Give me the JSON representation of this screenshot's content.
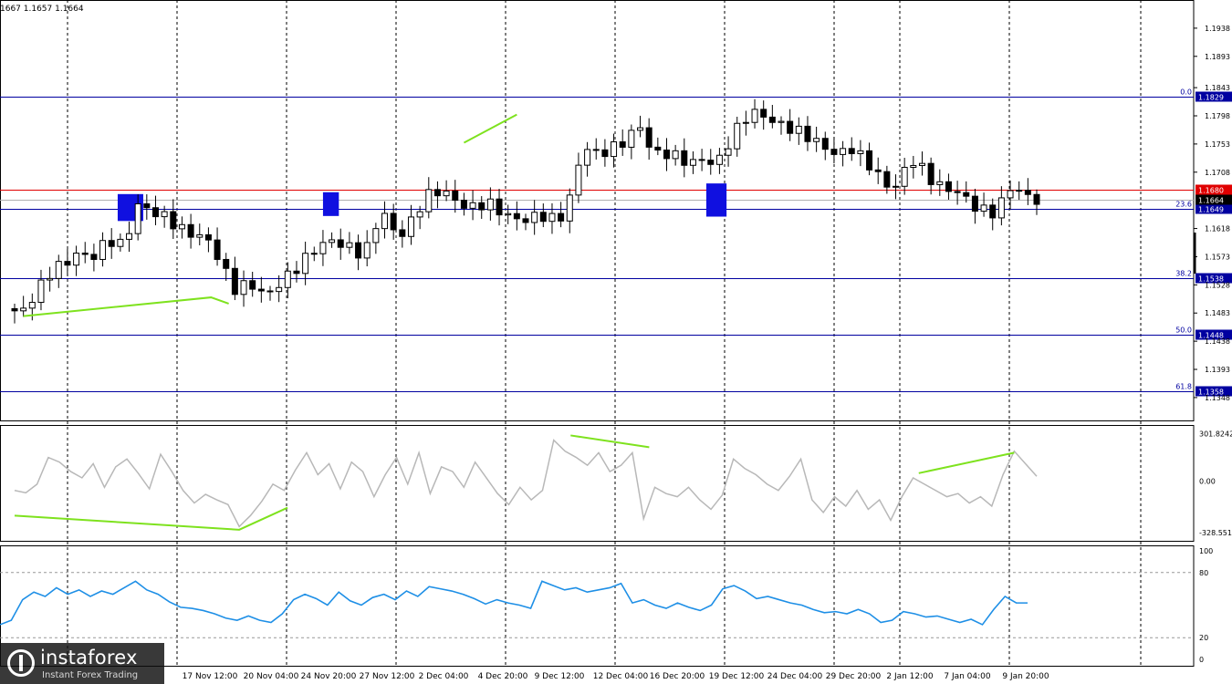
{
  "header": {
    "ohlc": "1667 1.1657 1.1664"
  },
  "logo": {
    "name": "instaforex",
    "tagline": "Instant Forex Trading"
  },
  "colors": {
    "background": "#ffffff",
    "grid": "#000000",
    "candle": "#000000",
    "level": "#0000a0",
    "resistance": "#e00000",
    "current": "#b0b0b0",
    "divergence": "#7ee21e",
    "zone": "#1010e0",
    "cci": "#b8b8b8",
    "rsi": "#1e8fe6"
  },
  "chart_data": [
    {
      "type": "candlestick",
      "name": "price",
      "ylim": [
        1.131,
        1.1983
      ],
      "y_ticks": [
        "1.1938",
        "1.1893",
        "1.1843",
        "1.1798",
        "1.1753",
        "1.1708",
        "1.1618",
        "1.1573",
        "1.1528",
        "1.1483",
        "1.1438",
        "1.1393",
        "1.1348"
      ],
      "x_ticks": [
        "17 Nov 12:00",
        "20 Nov 04:00",
        "24 Nov 20:00",
        "27 Nov 12:00",
        "2 Dec 04:00",
        "4 Dec 20:00",
        "9 Dec 12:00",
        "12 Dec 04:00",
        "16 Dec 20:00",
        "19 Dec 12:00",
        "24 Dec 04:00",
        "29 Dec 20:00",
        "2 Jan 12:00",
        "7 Jan 04:00",
        "9 Jan 20:00"
      ],
      "close_path": [
        [
          0,
          1.149
        ],
        [
          1,
          1.148
        ],
        [
          2,
          1.15
        ],
        [
          4,
          1.154
        ],
        [
          5,
          1.156
        ],
        [
          6,
          1.1555
        ],
        [
          7,
          1.158
        ],
        [
          9,
          1.157
        ],
        [
          11,
          1.16
        ],
        [
          13,
          1.159
        ],
        [
          14,
          1.166
        ],
        [
          15,
          1.165
        ],
        [
          17,
          1.164
        ],
        [
          18,
          1.163
        ],
        [
          20,
          1.161
        ],
        [
          22,
          1.1605
        ],
        [
          24,
          1.156
        ],
        [
          25,
          1.152
        ],
        [
          27,
          1.153
        ],
        [
          29,
          1.151
        ],
        [
          30,
          1.1525
        ],
        [
          32,
          1.155
        ],
        [
          34,
          1.158
        ],
        [
          36,
          1.16
        ],
        [
          38,
          1.159
        ],
        [
          40,
          1.1575
        ],
        [
          41,
          1.161
        ],
        [
          42,
          1.165
        ],
        [
          43,
          1.162
        ],
        [
          44,
          1.1605
        ],
        [
          45,
          1.162
        ],
        [
          47,
          1.167
        ],
        [
          49,
          1.168
        ],
        [
          50,
          1.1665
        ],
        [
          52,
          1.165
        ],
        [
          54,
          1.166
        ],
        [
          56,
          1.164
        ],
        [
          58,
          1.163
        ],
        [
          60,
          1.164
        ],
        [
          62,
          1.163
        ],
        [
          63,
          1.165
        ],
        [
          64,
          1.17
        ],
        [
          65,
          1.1755
        ],
        [
          66,
          1.1735
        ],
        [
          68,
          1.1745
        ],
        [
          70,
          1.176
        ],
        [
          71,
          1.179
        ],
        [
          72,
          1.176
        ],
        [
          73,
          1.1735
        ],
        [
          74,
          1.174
        ],
        [
          76,
          1.173
        ],
        [
          77,
          1.172
        ],
        [
          78,
          1.173
        ],
        [
          80,
          1.172
        ],
        [
          81,
          1.1745
        ],
        [
          82,
          1.177
        ],
        [
          83,
          1.179
        ],
        [
          84,
          1.1805
        ],
        [
          85,
          1.18
        ],
        [
          87,
          1.1785
        ],
        [
          89,
          1.1775
        ],
        [
          91,
          1.176
        ],
        [
          93,
          1.174
        ],
        [
          94,
          1.1735
        ],
        [
          95,
          1.175
        ],
        [
          97,
          1.1725
        ],
        [
          98,
          1.171
        ],
        [
          99,
          1.169
        ],
        [
          100,
          1.168
        ],
        [
          101,
          1.17
        ],
        [
          102,
          1.173
        ],
        [
          103,
          1.172
        ],
        [
          104,
          1.17
        ],
        [
          105,
          1.169
        ],
        [
          106,
          1.168
        ],
        [
          107,
          1.168
        ],
        [
          108,
          1.167
        ],
        [
          109,
          1.1655
        ],
        [
          110,
          1.165
        ],
        [
          111,
          1.164
        ],
        [
          112,
          1.165
        ],
        [
          113,
          1.168
        ],
        [
          114,
          1.1685
        ],
        [
          115,
          1.167
        ],
        [
          116,
          1.1664
        ]
      ],
      "horizontal_levels": [
        {
          "kind": "fibo",
          "label": "0.0",
          "value": 1.1829,
          "tag": "1.1829"
        },
        {
          "kind": "fibo",
          "label": "23.6",
          "value": 1.1649,
          "tag": "1.1649"
        },
        {
          "kind": "fibo",
          "label": "38.2",
          "value": 1.1538,
          "tag": "1.1538"
        },
        {
          "kind": "fibo",
          "label": "50.0",
          "value": 1.1448,
          "tag": "1.1448"
        },
        {
          "kind": "fibo",
          "label": "61.8",
          "value": 1.1358,
          "tag": "1.1358"
        },
        {
          "kind": "resistance",
          "label": "",
          "value": 1.168,
          "tag": "1.1680"
        },
        {
          "kind": "current",
          "label": "",
          "value": 1.1664,
          "tag": "1.1664"
        }
      ],
      "zones": [
        {
          "from": 11.7,
          "to": 14.6,
          "low": 1.163,
          "high": 1.1673
        },
        {
          "from": 35.0,
          "to": 36.8,
          "low": 1.1638,
          "high": 1.1676
        },
        {
          "from": 78.5,
          "to": 80.8,
          "low": 1.1637,
          "high": 1.169
        }
      ],
      "divergence_lines": [
        [
          [
            1,
            1.1478
          ],
          [
            22.3,
            1.1508
          ],
          [
            24.3,
            1.1498
          ]
        ],
        [
          [
            51.0,
            1.1755
          ],
          [
            57.0,
            1.18
          ]
        ]
      ]
    },
    {
      "type": "line",
      "name": "CCI",
      "ylim": [
        -340,
        310
      ],
      "y_ticks": [
        "301.8242",
        "0.00",
        "-328.5518"
      ],
      "series_path": [
        [
          0,
          -60
        ],
        [
          1,
          -75
        ],
        [
          2,
          -20
        ],
        [
          3,
          150
        ],
        [
          4,
          120
        ],
        [
          5,
          60
        ],
        [
          6,
          20
        ],
        [
          7,
          110
        ],
        [
          8,
          -40
        ],
        [
          9,
          90
        ],
        [
          10,
          140
        ],
        [
          11,
          50
        ],
        [
          12,
          -50
        ],
        [
          13,
          170
        ],
        [
          14,
          60
        ],
        [
          15,
          -60
        ],
        [
          16,
          -140
        ],
        [
          17,
          -85
        ],
        [
          18,
          -120
        ],
        [
          19,
          -150
        ],
        [
          20,
          -290
        ],
        [
          21,
          -220
        ],
        [
          22,
          -130
        ],
        [
          23,
          -20
        ],
        [
          24,
          -60
        ],
        [
          25,
          70
        ],
        [
          26,
          180
        ],
        [
          27,
          40
        ],
        [
          28,
          110
        ],
        [
          29,
          -50
        ],
        [
          30,
          120
        ],
        [
          31,
          60
        ],
        [
          32,
          -100
        ],
        [
          33,
          40
        ],
        [
          34,
          150
        ],
        [
          35,
          -20
        ],
        [
          36,
          180
        ],
        [
          37,
          -80
        ],
        [
          38,
          90
        ],
        [
          39,
          60
        ],
        [
          40,
          -40
        ],
        [
          41,
          120
        ],
        [
          42,
          20
        ],
        [
          43,
          -80
        ],
        [
          44,
          -150
        ],
        [
          45,
          -40
        ],
        [
          46,
          -120
        ],
        [
          47,
          -60
        ],
        [
          48,
          260
        ],
        [
          49,
          190
        ],
        [
          50,
          150
        ],
        [
          51,
          100
        ],
        [
          52,
          180
        ],
        [
          53,
          60
        ],
        [
          54,
          100
        ],
        [
          55,
          180
        ],
        [
          56,
          -240
        ],
        [
          57,
          -40
        ],
        [
          58,
          -80
        ],
        [
          59,
          -100
        ],
        [
          60,
          -40
        ],
        [
          61,
          -120
        ],
        [
          62,
          -180
        ],
        [
          63,
          -90
        ],
        [
          64,
          140
        ],
        [
          65,
          80
        ],
        [
          66,
          40
        ],
        [
          67,
          -20
        ],
        [
          68,
          -60
        ],
        [
          69,
          30
        ],
        [
          70,
          140
        ],
        [
          71,
          -120
        ],
        [
          72,
          -200
        ],
        [
          73,
          -100
        ],
        [
          74,
          -160
        ],
        [
          75,
          -60
        ],
        [
          76,
          -180
        ],
        [
          77,
          -120
        ],
        [
          78,
          -250
        ],
        [
          79,
          -100
        ],
        [
          80,
          20
        ],
        [
          81,
          -20
        ],
        [
          82,
          -60
        ],
        [
          83,
          -100
        ],
        [
          84,
          -80
        ],
        [
          85,
          -140
        ],
        [
          86,
          -100
        ],
        [
          87,
          -160
        ],
        [
          88,
          40
        ],
        [
          89,
          190
        ],
        [
          90,
          110
        ],
        [
          91,
          30
        ]
      ],
      "divergence_lines": [
        [
          [
            0,
            -220
          ],
          [
            20,
            -310
          ],
          [
            24.3,
            -170
          ]
        ],
        [
          [
            49.5,
            290
          ],
          [
            56.5,
            215
          ]
        ],
        [
          [
            80.5,
            50
          ],
          [
            89,
            180
          ]
        ]
      ]
    },
    {
      "type": "line",
      "name": "RSI",
      "ylim": [
        0,
        100
      ],
      "y_ticks": [
        "100",
        "80",
        "20",
        "0"
      ],
      "levels": [
        80,
        20
      ],
      "series_path": [
        [
          0,
          32
        ],
        [
          1,
          36
        ],
        [
          2,
          55
        ],
        [
          3,
          62
        ],
        [
          4,
          58
        ],
        [
          5,
          66
        ],
        [
          6,
          60
        ],
        [
          7,
          64
        ],
        [
          8,
          58
        ],
        [
          9,
          63
        ],
        [
          10,
          60
        ],
        [
          11,
          66
        ],
        [
          12,
          72
        ],
        [
          13,
          64
        ],
        [
          14,
          60
        ],
        [
          15,
          53
        ],
        [
          16,
          48
        ],
        [
          17,
          47
        ],
        [
          18,
          45
        ],
        [
          19,
          42
        ],
        [
          20,
          38
        ],
        [
          21,
          36
        ],
        [
          22,
          40
        ],
        [
          23,
          36
        ],
        [
          24,
          34
        ],
        [
          25,
          42
        ],
        [
          26,
          55
        ],
        [
          27,
          60
        ],
        [
          28,
          56
        ],
        [
          29,
          50
        ],
        [
          30,
          62
        ],
        [
          31,
          54
        ],
        [
          32,
          50
        ],
        [
          33,
          57
        ],
        [
          34,
          60
        ],
        [
          35,
          55
        ],
        [
          36,
          63
        ],
        [
          37,
          58
        ],
        [
          38,
          67
        ],
        [
          39,
          65
        ],
        [
          40,
          63
        ],
        [
          41,
          60
        ],
        [
          42,
          56
        ],
        [
          43,
          51
        ],
        [
          44,
          55
        ],
        [
          45,
          52
        ],
        [
          46,
          50
        ],
        [
          47,
          47
        ],
        [
          48,
          72
        ],
        [
          49,
          68
        ],
        [
          50,
          64
        ],
        [
          51,
          66
        ],
        [
          52,
          62
        ],
        [
          53,
          64
        ],
        [
          54,
          66
        ],
        [
          55,
          70
        ],
        [
          56,
          52
        ],
        [
          57,
          55
        ],
        [
          58,
          50
        ],
        [
          59,
          47
        ],
        [
          60,
          52
        ],
        [
          61,
          48
        ],
        [
          62,
          45
        ],
        [
          63,
          50
        ],
        [
          64,
          65
        ],
        [
          65,
          68
        ],
        [
          66,
          63
        ],
        [
          67,
          56
        ],
        [
          68,
          58
        ],
        [
          69,
          55
        ],
        [
          70,
          52
        ],
        [
          71,
          50
        ],
        [
          72,
          46
        ],
        [
          73,
          43
        ],
        [
          74,
          44
        ],
        [
          75,
          42
        ],
        [
          76,
          46
        ],
        [
          77,
          42
        ],
        [
          78,
          34
        ],
        [
          79,
          36
        ],
        [
          80,
          44
        ],
        [
          81,
          42
        ],
        [
          82,
          39
        ],
        [
          83,
          40
        ],
        [
          84,
          37
        ],
        [
          85,
          34
        ],
        [
          86,
          37
        ],
        [
          87,
          32
        ],
        [
          88,
          46
        ],
        [
          89,
          58
        ],
        [
          90,
          52
        ],
        [
          91,
          52
        ]
      ]
    }
  ]
}
